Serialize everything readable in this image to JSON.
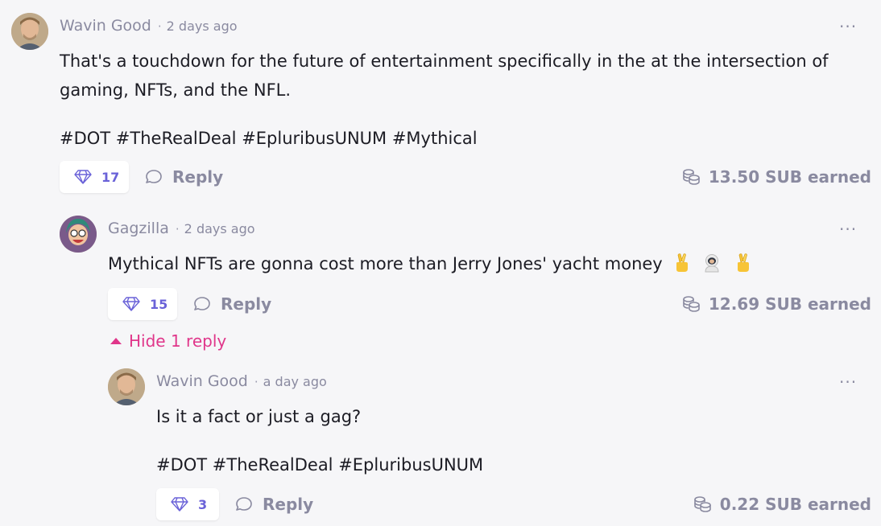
{
  "comments": [
    {
      "author": "Wavin Good",
      "time": "2 days ago",
      "body_line1": "That's a touchdown for the future of entertainment specifically in the at the intersection of",
      "body_line2": "gaming, NFTs, and the NFL.",
      "hashtags": "#DOT #TheRealDeal #EpluribusUNUM #Mythical",
      "likes": "17",
      "reply_label": "Reply",
      "earned": "13.50 SUB earned"
    },
    {
      "author": "Gagzilla",
      "time": "2 days ago",
      "body_line1": "Mythical NFTs are gonna cost more than Jerry Jones' yacht money",
      "emojis": [
        "crossed-fingers",
        "astronaut",
        "crossed-fingers"
      ],
      "likes": "15",
      "reply_label": "Reply",
      "earned": "12.69 SUB earned",
      "hide_replies_label": "Hide 1 reply"
    },
    {
      "author": "Wavin Good",
      "time": "a day ago",
      "body_line1": "Is it a fact or just a gag?",
      "hashtags": "#DOT #TheRealDeal #EpluribusUNUM",
      "likes": "3",
      "reply_label": "Reply",
      "earned": "0.22 SUB earned"
    }
  ],
  "separator": "·",
  "more_label": "···",
  "colors": {
    "background": "#f6f6f8",
    "muted_text": "#8a8aa0",
    "like_accent": "#6a62d8",
    "hide_reply_pink": "#e0368a"
  }
}
